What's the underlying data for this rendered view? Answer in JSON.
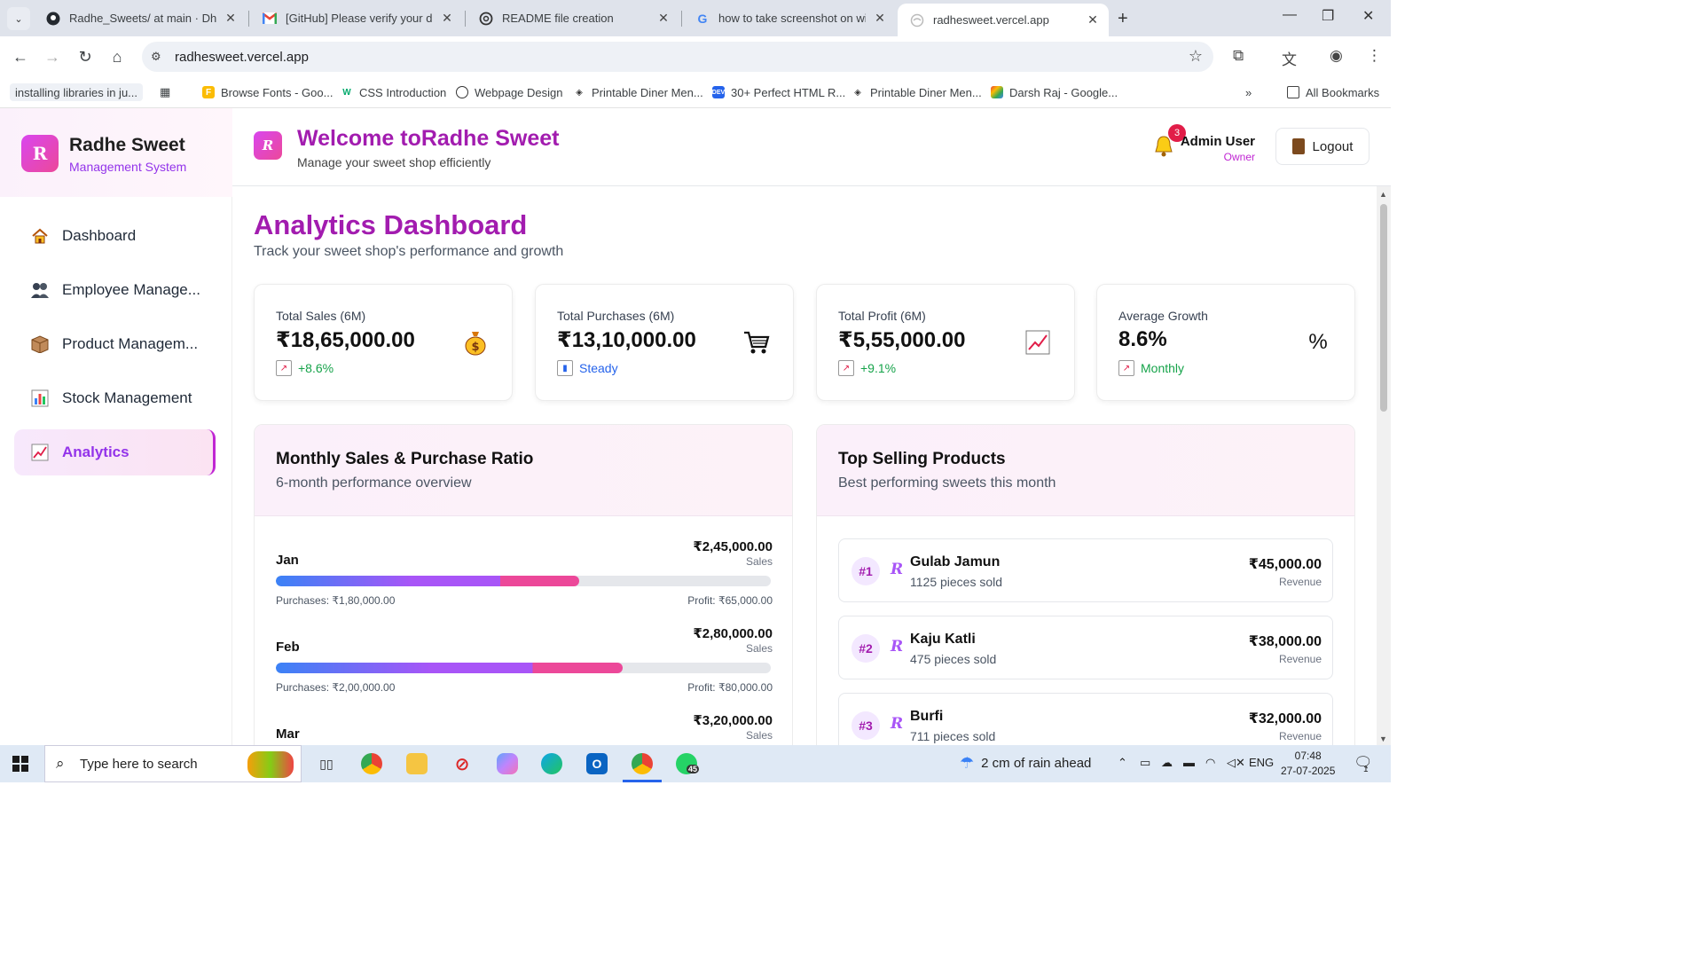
{
  "browser": {
    "tabs": [
      {
        "title": "Radhe_Sweets/ at main · Dhruv",
        "icon": "github-icon"
      },
      {
        "title": "[GitHub] Please verify your devi",
        "icon": "gmail-icon"
      },
      {
        "title": "README file creation",
        "icon": "openai-icon"
      },
      {
        "title": "how to take screenshot on wind",
        "icon": "google-icon"
      },
      {
        "title": "radhesweet.vercel.app",
        "icon": "globe-icon"
      }
    ],
    "url": "radhesweet.vercel.app",
    "bookmarks": [
      "installing libraries in ju...",
      "Browse Fonts - Goo...",
      "CSS Introduction",
      "Webpage Design",
      "Printable Diner Men...",
      "30+ Perfect HTML R...",
      "Printable Diner Men...",
      "Darsh Raj - Google...",
      "All Bookmarks"
    ]
  },
  "sidebar": {
    "brand_name": "Radhe Sweet",
    "brand_sub": "Management System",
    "items": [
      {
        "label": "Dashboard",
        "icon": "house-icon"
      },
      {
        "label": "Employee Manage...",
        "icon": "people-icon"
      },
      {
        "label": "Product Managem...",
        "icon": "box-icon"
      },
      {
        "label": "Stock Management",
        "icon": "bar-chart-icon"
      },
      {
        "label": "Analytics",
        "icon": "trend-chart-icon"
      }
    ]
  },
  "header": {
    "welcome": "Welcome toRadhe Sweet",
    "subtitle": "Manage your sweet shop efficiently",
    "notification_count": "3",
    "user_name": "Admin User",
    "user_role": "Owner",
    "logout_label": "Logout"
  },
  "page": {
    "title": "Analytics Dashboard",
    "subtitle": "Track your sweet shop's performance and growth"
  },
  "stats": [
    {
      "label": "Total Sales (6M)",
      "value": "₹18,65,000.00",
      "trend": "+8.6%",
      "trend_color": "#16a34a",
      "icon": "money-bag-icon"
    },
    {
      "label": "Total Purchases (6M)",
      "value": "₹13,10,000.00",
      "trend": "Steady",
      "trend_color": "#2563eb",
      "icon": "cart-icon"
    },
    {
      "label": "Total Profit (6M)",
      "value": "₹5,55,000.00",
      "trend": "+9.1%",
      "trend_color": "#16a34a",
      "icon": "trend-chart-icon"
    },
    {
      "label": "Average Growth",
      "value": "8.6%",
      "trend": "Monthly",
      "trend_color": "#16a34a",
      "icon": "percent-icon"
    }
  ],
  "monthly": {
    "title": "Monthly Sales & Purchase Ratio",
    "subtitle": "6-month performance overview",
    "rows": [
      {
        "month": "Jan",
        "sales": "₹2,45,000.00",
        "sales_label": "Sales",
        "purchases": "Purchases: ₹1,80,000.00",
        "profit": "Profit: ₹65,000.00",
        "fill": 0.613
      },
      {
        "month": "Feb",
        "sales": "₹2,80,000.00",
        "sales_label": "Sales",
        "purchases": "Purchases: ₹2,00,000.00",
        "profit": "Profit: ₹80,000.00",
        "fill": 0.7
      },
      {
        "month": "Mar",
        "sales": "₹3,20,000.00",
        "sales_label": "Sales",
        "purchases": "",
        "profit": "",
        "fill": 0.8
      }
    ]
  },
  "top_products": {
    "title": "Top Selling Products",
    "subtitle": "Best performing sweets this month",
    "items": [
      {
        "rank": "#1",
        "name": "Gulab Jamun",
        "qty": "1125 pieces sold",
        "revenue": "₹45,000.00",
        "revenue_label": "Revenue"
      },
      {
        "rank": "#2",
        "name": "Kaju Katli",
        "qty": "475 pieces sold",
        "revenue": "₹38,000.00",
        "revenue_label": "Revenue"
      },
      {
        "rank": "#3",
        "name": "Burfi",
        "qty": "711 pieces sold",
        "revenue": "₹32,000.00",
        "revenue_label": "Revenue"
      }
    ]
  },
  "taskbar": {
    "search_placeholder": "Type here to search",
    "weather": "2 cm of rain ahead",
    "lang": "ENG",
    "time": "07:48",
    "date": "27-07-2025",
    "whatsapp_badge": "45",
    "notif_count": "1"
  }
}
